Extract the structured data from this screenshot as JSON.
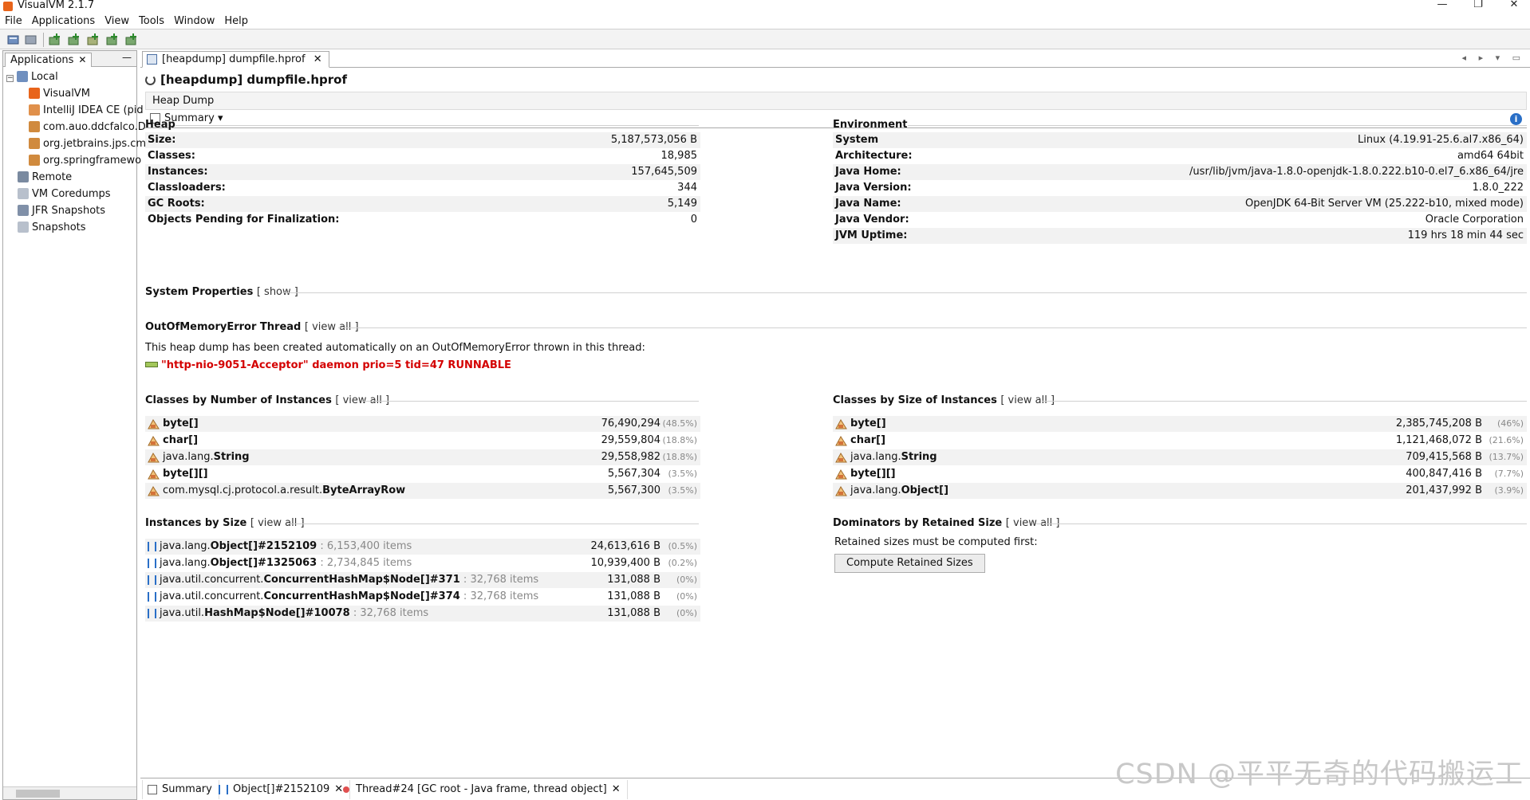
{
  "window": {
    "title": "VisualVM 2.1.7",
    "min": "—",
    "restore": "❐",
    "close": "✕"
  },
  "menu": [
    "File",
    "Applications",
    "View",
    "Tools",
    "Window",
    "Help"
  ],
  "left_panel": {
    "tab": "Applications",
    "tree": {
      "local": "Local",
      "children": [
        "VisualVM",
        "IntelliJ IDEA CE (pid",
        "com.auo.ddcfalco.D",
        "org.jetbrains.jps.cm",
        "org.springframewo"
      ],
      "remote": "Remote",
      "coredumps": "VM Coredumps",
      "jfr": "JFR Snapshots",
      "snapshots": "Snapshots"
    }
  },
  "doc_tab": "[heapdump] dumpfile.hprof",
  "heading": "[heapdump] dumpfile.hprof",
  "heap_dump_label": "Heap Dump",
  "summary_label": "Summary",
  "heap": {
    "title": "Heap",
    "rows": [
      {
        "k": "Size:",
        "v": "5,187,573,056 B"
      },
      {
        "k": "Classes:",
        "v": "18,985"
      },
      {
        "k": "Instances:",
        "v": "157,645,509"
      },
      {
        "k": "Classloaders:",
        "v": "344"
      },
      {
        "k": "GC Roots:",
        "v": "5,149"
      },
      {
        "k": "Objects Pending for Finalization:",
        "v": "0"
      }
    ]
  },
  "environment": {
    "title": "Environment",
    "rows": [
      {
        "k": "System",
        "v": "Linux (4.19.91-25.6.al7.x86_64)"
      },
      {
        "k": "Architecture:",
        "v": "amd64 64bit"
      },
      {
        "k": "Java Home:",
        "v": "/usr/lib/jvm/java-1.8.0-openjdk-1.8.0.222.b10-0.el7_6.x86_64/jre"
      },
      {
        "k": "Java Version:",
        "v": "1.8.0_222"
      },
      {
        "k": "Java Name:",
        "v": "OpenJDK 64-Bit Server VM (25.222-b10, mixed mode)"
      },
      {
        "k": "Java Vendor:",
        "v": "Oracle Corporation"
      },
      {
        "k": "JVM Uptime:",
        "v": "119 hrs 18 min 44 sec"
      }
    ]
  },
  "system_properties": {
    "title": "System Properties",
    "link": "[ show ]"
  },
  "oom": {
    "title": "OutOfMemoryError Thread",
    "link": "[ view all ]",
    "text": "This heap dump has been created automatically on an OutOfMemoryError thrown in this thread:",
    "thread": "\"http-nio-9051-Acceptor\" daemon prio=5 tid=47 RUNNABLE"
  },
  "classes_by_count": {
    "title": "Classes by Number of Instances",
    "link": "[ view all ]",
    "rows": [
      {
        "pre": "",
        "name": "byte[]",
        "count": "76,490,294",
        "pct": "(48.5%)"
      },
      {
        "pre": "",
        "name": "char[]",
        "count": "29,559,804",
        "pct": "(18.8%)"
      },
      {
        "pre": "java.lang.",
        "name": "String",
        "count": "29,558,982",
        "pct": "(18.8%)"
      },
      {
        "pre": "",
        "name": "byte[][]",
        "count": "5,567,304",
        "pct": "(3.5%)"
      },
      {
        "pre": "com.mysql.cj.protocol.a.result.",
        "name": "ByteArrayRow",
        "count": "5,567,300",
        "pct": "(3.5%)"
      }
    ]
  },
  "classes_by_size": {
    "title": "Classes by Size of Instances",
    "link": "[ view all ]",
    "rows": [
      {
        "pre": "",
        "name": "byte[]",
        "count": "2,385,745,208 B",
        "pct": "(46%)"
      },
      {
        "pre": "",
        "name": "char[]",
        "count": "1,121,468,072 B",
        "pct": "(21.6%)"
      },
      {
        "pre": "java.lang.",
        "name": "String",
        "count": "709,415,568 B",
        "pct": "(13.7%)"
      },
      {
        "pre": "",
        "name": "byte[][]",
        "count": "400,847,416 B",
        "pct": "(7.7%)"
      },
      {
        "pre": "java.lang.",
        "name": "Object[]",
        "count": "201,437,992 B",
        "pct": "(3.9%)"
      }
    ]
  },
  "instances_by_size": {
    "title": "Instances by Size",
    "link": "[ view all ]",
    "rows": [
      {
        "pre": "java.lang.",
        "name": "Object[]#2152109",
        "meta": " : 6,153,400 items",
        "count": "24,613,616 B",
        "pct": "(0.5%)"
      },
      {
        "pre": "java.lang.",
        "name": "Object[]#1325063",
        "meta": " : 2,734,845 items",
        "count": "10,939,400 B",
        "pct": "(0.2%)"
      },
      {
        "pre": "java.util.concurrent.",
        "name": "ConcurrentHashMap$Node[]#371",
        "meta": " : 32,768 items",
        "count": "131,088 B",
        "pct": "(0%)"
      },
      {
        "pre": "java.util.concurrent.",
        "name": "ConcurrentHashMap$Node[]#374",
        "meta": " : 32,768 items",
        "count": "131,088 B",
        "pct": "(0%)"
      },
      {
        "pre": "java.util.",
        "name": "HashMap$Node[]#10078",
        "meta": " : 32,768 items",
        "count": "131,088 B",
        "pct": "(0%)"
      }
    ]
  },
  "dominators": {
    "title": "Dominators by Retained Size",
    "link": "[ view all ]",
    "text": "Retained sizes must be computed first:",
    "button": "Compute Retained Sizes"
  },
  "bottom_tabs": [
    "Summary",
    "Object[]#2152109",
    "Thread#24 [GC root - Java frame, thread object]"
  ],
  "watermark": "CSDN @平平无奇的代码搬运工"
}
